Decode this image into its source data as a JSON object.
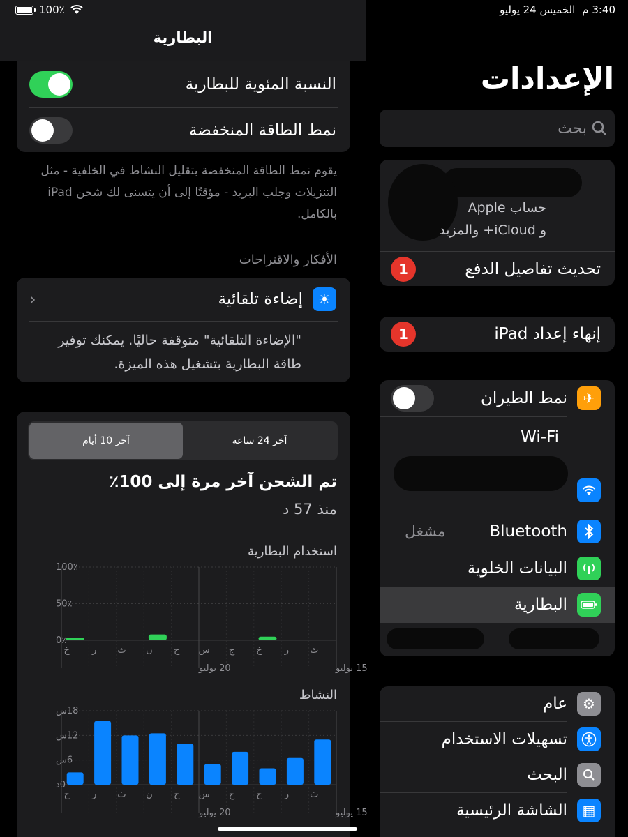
{
  "status_bar": {
    "time": "3:40 م",
    "date": "الخميس 24 يوليو",
    "battery": "100٪"
  },
  "settings": {
    "title": "الإعدادات",
    "search_placeholder": "بحث",
    "account": {
      "line1": "حساب Apple",
      "line2": "و iCloud+ والمزيد"
    },
    "payment_update": {
      "label": "تحديث تفاصيل الدفع",
      "badge": "1"
    },
    "finish_setup": {
      "label": "إنهاء إعداد iPad",
      "badge": "1"
    },
    "connectivity": [
      {
        "name": "airplane",
        "label": "نمط الطيران",
        "icon": "airplane-icon",
        "color": "#ff9f0a"
      },
      {
        "name": "wifi",
        "label": "Wi-Fi",
        "icon": "wifi-icon",
        "color": "#0a84ff"
      },
      {
        "name": "bluetooth",
        "label": "Bluetooth",
        "value": "مشغل",
        "icon": "bluetooth-icon",
        "color": "#0a84ff"
      },
      {
        "name": "cellular",
        "label": "البيانات الخلوية",
        "icon": "cellular-icon",
        "color": "#30d158"
      },
      {
        "name": "battery",
        "label": "البطارية",
        "icon": "battery-icon",
        "color": "#30d158"
      }
    ],
    "general": [
      {
        "name": "general",
        "label": "عام",
        "icon": "gear-icon",
        "color": "#8e8e93"
      },
      {
        "name": "accessibility",
        "label": "تسهيلات الاستخدام",
        "icon": "accessibility-icon",
        "color": "#0a84ff"
      },
      {
        "name": "search",
        "label": "البحث",
        "icon": "search-icon",
        "color": "#8e8e93"
      },
      {
        "name": "home-screen",
        "label": "الشاشة الرئيسية",
        "icon": "home-screen-icon",
        "color": "#0a84ff"
      }
    ]
  },
  "battery_page": {
    "nav_title": "البطارية",
    "battery_percentage": {
      "label": "النسبة المئوية للبطارية",
      "on": true
    },
    "low_power": {
      "label": "نمط الطاقة المنخفضة",
      "on": false
    },
    "low_power_note": "يقوم نمط الطاقة المنخفضة بتقليل النشاط في الخلفية - مثل التنزيلات وجلب البريد - مؤقتًا إلى أن يتسنى لك شحن iPad بالكامل.",
    "insights_header": "الأفكار والاقتراحات",
    "auto_brightness": {
      "label": "إضاءة تلقائية",
      "note": "\"الإضاءة التلقائية\" متوقفة حاليًا. يمكنك توفير طاقة البطارية بتشغيل هذه الميزة."
    },
    "tabs": [
      {
        "label": "آخر 10 أيام",
        "active": true
      },
      {
        "label": "آخر 24 ساعة",
        "active": false
      }
    ],
    "last_charged": {
      "title": "تم الشحن آخر مرة إلى 100٪",
      "subtitle": "منذ 57 د"
    },
    "usage_title": "استخدام البطارية",
    "activity_title": "النشاط",
    "usage_y_labels": [
      "100٪",
      "50٪",
      "0٪"
    ],
    "activity_y_labels": [
      "18س",
      "12س",
      "6س",
      "0د"
    ],
    "day_labels": [
      "خ",
      "ر",
      "ث",
      "ن",
      "ح",
      "س",
      "ج",
      "خ",
      "ر",
      "ث"
    ],
    "date_labels": [
      "20 يوليو",
      "15 يوليو"
    ]
  },
  "chart_data": [
    {
      "type": "bar",
      "title": "استخدام البطارية",
      "categories": [
        "خ",
        "ر",
        "ث",
        "ن",
        "ح",
        "س",
        "ج",
        "خ",
        "ر",
        "ث"
      ],
      "values": [
        1,
        0,
        0,
        8,
        0,
        0,
        0,
        5,
        0,
        0
      ],
      "ylim": [
        0,
        100
      ],
      "color": "#30d158"
    },
    {
      "type": "bar",
      "title": "النشاط",
      "categories": [
        "خ",
        "ر",
        "ث",
        "ن",
        "ح",
        "س",
        "ج",
        "خ",
        "ر",
        "ث"
      ],
      "values": [
        3,
        15.5,
        12,
        12.5,
        10,
        5,
        8,
        4,
        6.5,
        11
      ],
      "ylim": [
        0,
        18
      ],
      "color": "#0a84ff"
    }
  ]
}
